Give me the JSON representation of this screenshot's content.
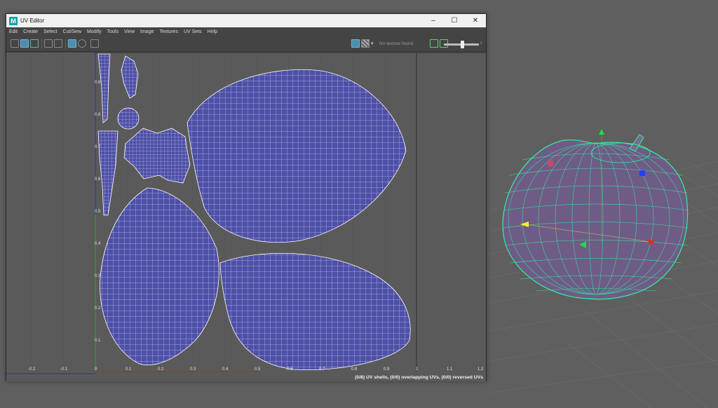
{
  "window": {
    "title": "UV Editor",
    "app_icon_letter": "M",
    "minimize": "–",
    "maximize": "☐",
    "close": "✕"
  },
  "menu": [
    "Edit",
    "Create",
    "Select",
    "Cut/Sew",
    "Modify",
    "Tools",
    "View",
    "Image",
    "Textures",
    "UV Sets",
    "Help"
  ],
  "toolbar": {
    "texture_status": "No texture found"
  },
  "axis": {
    "x_ticks": [
      "-0.2",
      "-0.1",
      "0",
      "0.1",
      "0.2",
      "0.3",
      "0.4",
      "0.5",
      "0.6",
      "0.7",
      "0.8",
      "0.9",
      "1",
      "1.1",
      "1.2"
    ],
    "y_ticks": [
      "0.9",
      "0.8",
      "0.7",
      "0.6",
      "0.5",
      "0.4",
      "0.3",
      "0.2",
      "0.1"
    ]
  },
  "status": "(0/8) UV shells, (0/0) overlapping UVs, (0/0) reversed UVs",
  "colors": {
    "uv_shell_fill": "#4e50a8",
    "uv_grid_line": "#ffffff",
    "mesh_wire": "#33f0a0",
    "apple_fill": "#6e5c86"
  }
}
